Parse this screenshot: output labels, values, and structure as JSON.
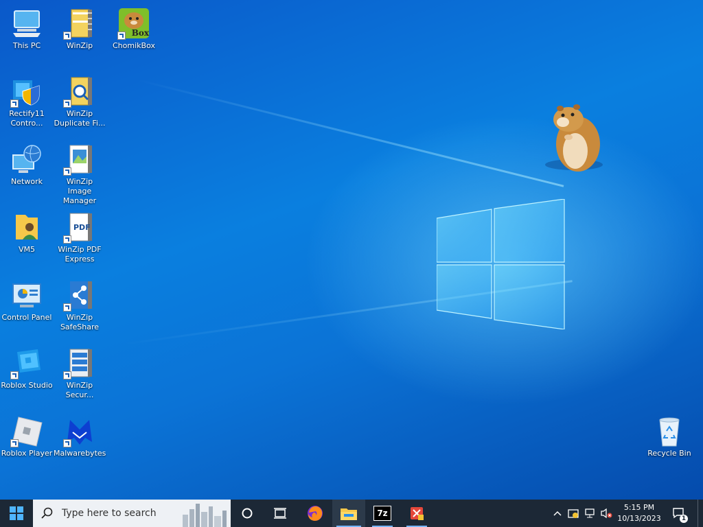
{
  "desktop": {
    "icons": [
      {
        "label": "This PC",
        "icon": "this-pc-icon"
      },
      {
        "label": "WinZip",
        "icon": "winzip-icon"
      },
      {
        "label": "ChomikBox",
        "icon": "chomikbox-icon"
      },
      {
        "label": "Rectify11 Contro...",
        "icon": "rectify11-icon"
      },
      {
        "label": "WinZip Duplicate Fi...",
        "icon": "winzip-duplicate-icon"
      },
      {
        "label": "Network",
        "icon": "network-icon"
      },
      {
        "label": "WinZip Image Manager",
        "icon": "winzip-image-icon"
      },
      {
        "label": "VM5",
        "icon": "user-folder-icon"
      },
      {
        "label": "WinZip PDF Express",
        "icon": "winzip-pdf-icon"
      },
      {
        "label": "Control Panel",
        "icon": "control-panel-icon"
      },
      {
        "label": "WinZip SafeShare",
        "icon": "winzip-safeshare-icon"
      },
      {
        "label": "Roblox Studio",
        "icon": "roblox-studio-icon"
      },
      {
        "label": "WinZip Secur...",
        "icon": "winzip-secure-icon"
      },
      {
        "label": "Roblox Player",
        "icon": "roblox-player-icon"
      },
      {
        "label": "Malwarebytes",
        "icon": "malwarebytes-icon"
      },
      {
        "label": "Recycle Bin",
        "icon": "recycle-bin-icon"
      }
    ],
    "chomikbox_badge": "Box",
    "pdf_badge": "PDF"
  },
  "taskbar": {
    "search_placeholder": "Type here to search",
    "sevenzip_label": "7z",
    "clock": {
      "time": "5:15 PM",
      "date": "10/13/2023"
    },
    "notification_count": "1"
  },
  "colors": {
    "taskbar": "#1c2836",
    "accent": "#77b6ff"
  }
}
